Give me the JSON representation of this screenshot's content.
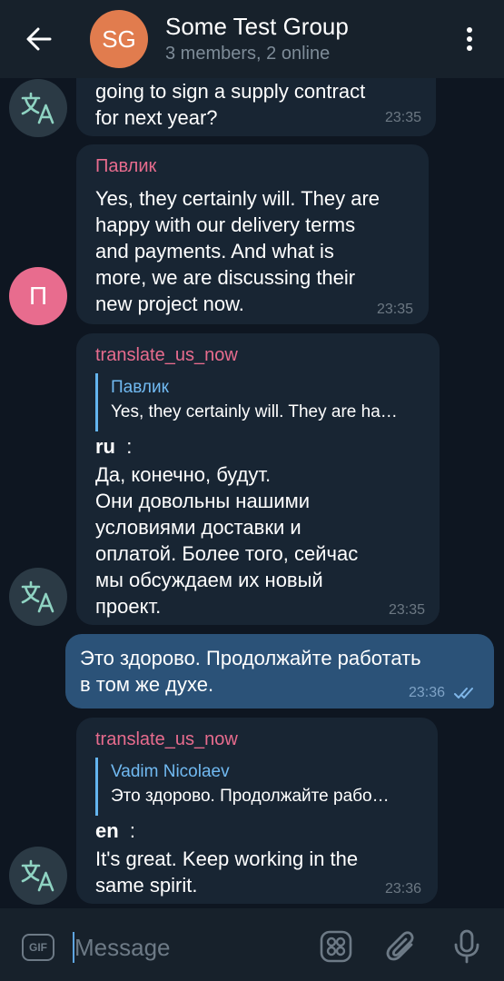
{
  "header": {
    "title": "Some Test Group",
    "subtitle": "3 members, 2 online",
    "avatar_initials": "SG",
    "avatar_color": "#e17c4e"
  },
  "messages": [
    {
      "kind": "incoming",
      "avatar": "translate-icon",
      "text": "going to sign a supply contract\nfor next year?",
      "time": "23:35"
    },
    {
      "kind": "incoming",
      "sender": "Павлик",
      "sender_color": "#e86c8e",
      "avatar_initial": "П",
      "text": "Yes, they certainly will. They are\nhappy with our delivery terms\nand payments. And what is\nmore, we are discussing their\nnew project now.",
      "time": "23:35"
    },
    {
      "kind": "incoming",
      "sender": "translate_us_now",
      "sender_color": "#e86c8e",
      "avatar": "translate-icon",
      "reply": {
        "name": "Павлик",
        "text": "Yes, they certainly will. They are ha…"
      },
      "lang": "ru",
      "lang_sep": ":",
      "text": "Да, конечно, будут.\nОни довольны нашими\nусловиями доставки и\nоплатой. Более того, сейчас\nмы обсуждаем их новый\nпроект.",
      "time": "23:35"
    },
    {
      "kind": "outgoing",
      "text": "Это здорово. Продолжайте работать\nв том же духе.",
      "time": "23:36",
      "status": "read-double-check-icon"
    },
    {
      "kind": "incoming",
      "sender": "translate_us_now",
      "sender_color": "#e86c8e",
      "avatar": "translate-icon",
      "reply": {
        "name": "Vadim Nicolaev",
        "text": "Это здорово. Продолжайте рабо…"
      },
      "lang": "en",
      "lang_sep": ":",
      "text": "It's great. Keep working in the\nsame spirit.",
      "time": "23:36"
    }
  ],
  "composer": {
    "gif_label": "GIF",
    "placeholder": "Message"
  },
  "icons": [
    "back-arrow-icon",
    "more-vertical-icon",
    "translate-icon",
    "gif-icon",
    "sticker-grid-icon",
    "attach-paperclip-icon",
    "microphone-icon",
    "read-double-check-icon"
  ],
  "colors": {
    "background": "#0e1621",
    "bar": "#17212b",
    "incoming_bubble": "#182533",
    "outgoing_bubble": "#2b5278",
    "sender_name": "#e86c8e",
    "reply_accent": "#64b5ef",
    "avatar_user": "#e86c8e",
    "avatar_bot": "#2b3a45"
  }
}
